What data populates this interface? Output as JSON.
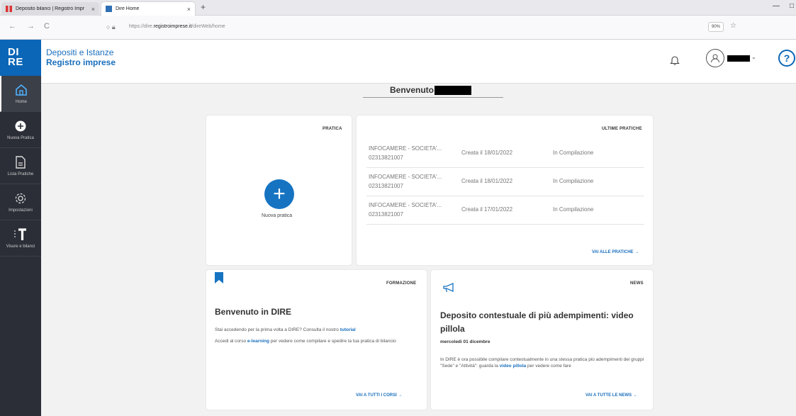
{
  "browser": {
    "tabs": [
      {
        "title": "Deposito bilanci | Registro Impr",
        "close": "×"
      },
      {
        "title": "Dire Home",
        "close": "×"
      }
    ],
    "new_tab": "+",
    "minimize": "—",
    "maximize": "□",
    "back": "←",
    "forward": "→",
    "reload": "C",
    "url_prefix": "https://dire.",
    "url_domain": "registroimprese.it",
    "url_path": "/direWeb/home",
    "zoom": "90%",
    "bookmark_star": "☆"
  },
  "sidebar": {
    "logo_line1": "DI",
    "logo_line2": "RE",
    "items": [
      {
        "label": "Home"
      },
      {
        "label": "Nuova Pratica"
      },
      {
        "label": "Lista Pratiche"
      },
      {
        "label": "Impostazioni"
      },
      {
        "label": "Visure e bilanci"
      }
    ]
  },
  "header": {
    "line1": "Depositi e Istanze",
    "line2": "Registro imprese",
    "caret": "⌄",
    "help": "?"
  },
  "welcome": {
    "text": "Benvenuto"
  },
  "pratica_card": {
    "tag": "PRATICA",
    "plus": "+",
    "label": "Nuova pratica"
  },
  "ultime_pratiche": {
    "tag": "ULTIME PRATICHE",
    "rows": [
      {
        "name": "INFOCAMERE - SOCIETA'...",
        "code": "02313821007",
        "date": "Creata il 18/01/2022",
        "status": "In Compilazione"
      },
      {
        "name": "INFOCAMERE - SOCIETA'...",
        "code": "02313821007",
        "date": "Creata il 18/01/2022",
        "status": "In Compilazione"
      },
      {
        "name": "INFOCAMERE - SOCIETA'...",
        "code": "02313821007",
        "date": "Creata il 17/01/2022",
        "status": "In Compilazione"
      }
    ],
    "link": "VAI ALLE PRATICHE →"
  },
  "formazione": {
    "tag": "FORMAZIONE",
    "title": "Benvenuto in DIRE",
    "p1_pre": "Stai accedendo per la prima volta a DIRE? Consulta il nostro ",
    "p1_link": "tutorial",
    "p2_pre": "Accedi al corso ",
    "p2_link": "e-learning",
    "p2_post": " per vedere come compilare e spedire la tua pratica di bilancio",
    "link": "VAI A TUTTI I CORSI →"
  },
  "news": {
    "tag": "NEWS",
    "title_line1": "Deposito contestuale di più adempimenti: video",
    "title_line2": "pillola",
    "date": "mercoledì 01 dicembre",
    "body_pre": "In DIRE è ora possibile compilare contestualmente in una stessa pratica più adempimenti dei gruppi \"Sede\" e \"Attività\": guarda la ",
    "body_link": "video pillola",
    "body_post": " per vedere come fare",
    "link": "VAI A TUTTE LE NEWS →"
  },
  "colors": {
    "primary": "#0b66b7",
    "sidebar": "#2b2e36"
  }
}
